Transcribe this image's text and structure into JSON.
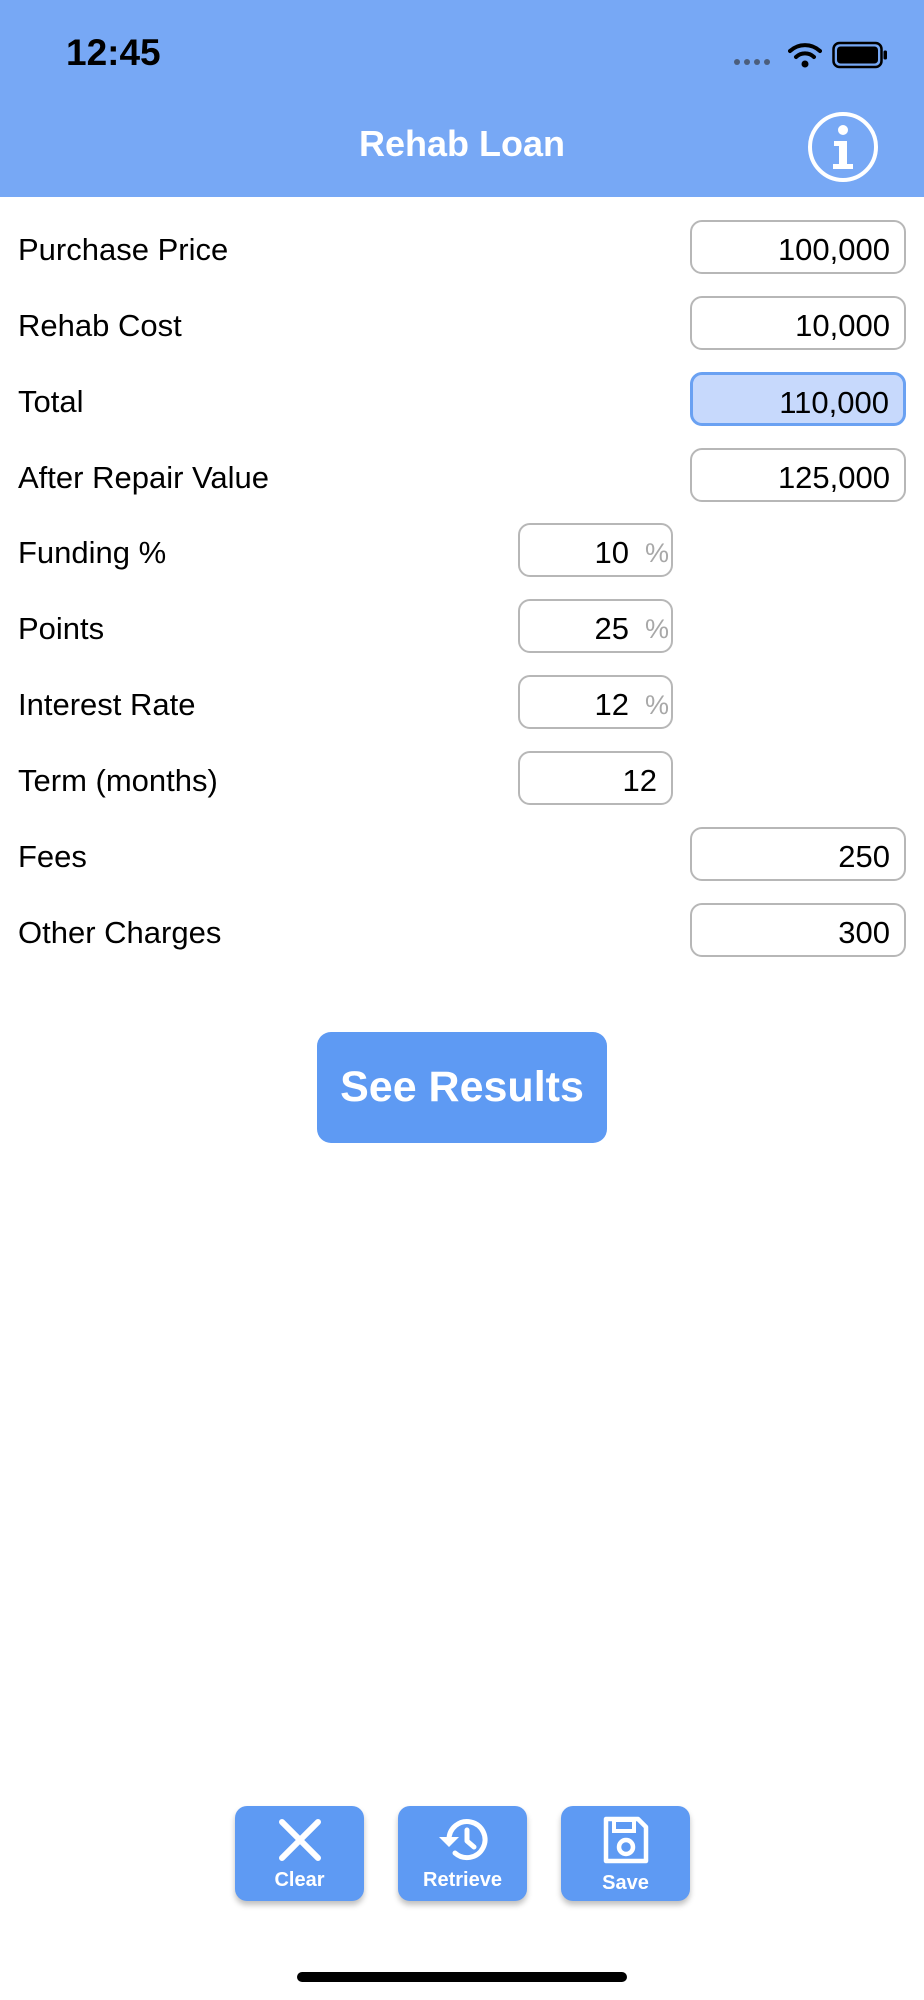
{
  "status_bar": {
    "time": "12:45"
  },
  "nav": {
    "title": "Rehab Loan",
    "info_icon": "info-icon"
  },
  "fields": [
    {
      "label": "Purchase Price",
      "value": "100,000"
    },
    {
      "label": "Rehab Cost",
      "value": "10,000"
    },
    {
      "label": "Total",
      "value": "110,000"
    },
    {
      "label": "After Repair Value",
      "value": "125,000"
    },
    {
      "label": "Funding %",
      "value": "10",
      "unit": "%"
    },
    {
      "label": "Points",
      "value": "25",
      "unit": "%"
    },
    {
      "label": "Interest Rate",
      "value": "12",
      "unit": "%"
    },
    {
      "label": "Term (months)",
      "value": "12"
    },
    {
      "label": "Fees",
      "value": "250"
    },
    {
      "label": "Other Charges",
      "value": "300"
    }
  ],
  "actions": {
    "see_results": "See Results"
  },
  "toolbar": {
    "clear": {
      "label": "Clear",
      "icon": "close-icon"
    },
    "retrieve": {
      "label": "Retrieve",
      "icon": "history-icon"
    },
    "save": {
      "label": "Save",
      "icon": "save-icon"
    }
  },
  "colors": {
    "header": "#77a8f5",
    "button": "#5e9af3",
    "highlight_fill": "#c7d9fc",
    "highlight_border": "#6aa1f2"
  }
}
